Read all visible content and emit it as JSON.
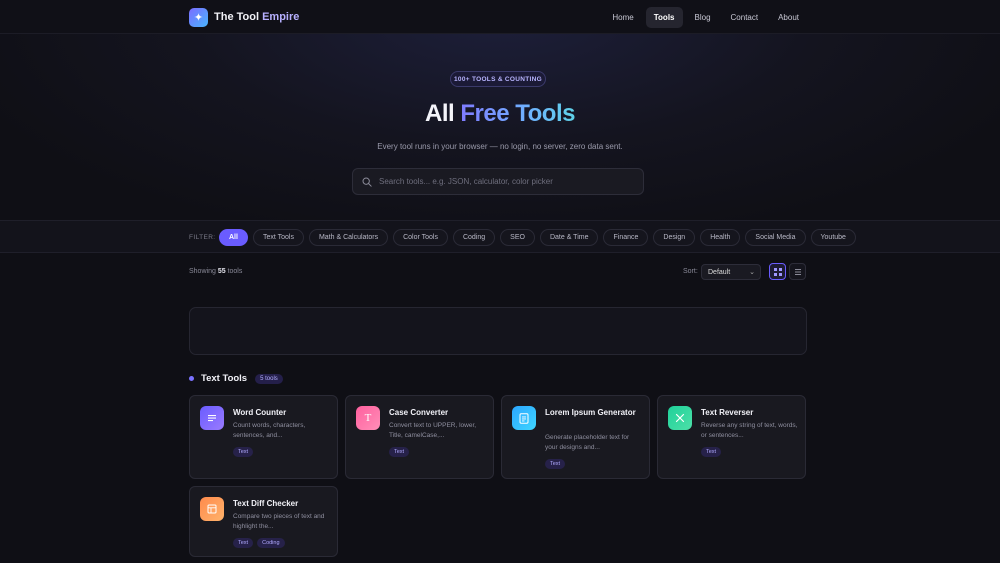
{
  "brand": {
    "name_part1": "The Tool ",
    "name_part2": "Empire"
  },
  "nav": {
    "links": [
      "Home",
      "Tools",
      "Blog",
      "Contact",
      "About"
    ],
    "active": "Tools"
  },
  "hero": {
    "badge": "100+ TOOLS & COUNTING",
    "title_part1": "All",
    "title_part2": "Free Tools",
    "subtitle": "Every tool runs in your browser — no login, no server, zero data sent.",
    "search_placeholder": "Search tools... e.g. JSON, calculator, color picker"
  },
  "filter": {
    "label": "FILTER:",
    "chips": [
      "All",
      "Text Tools",
      "Math & Calculators",
      "Color Tools",
      "Coding",
      "SEO",
      "Date & Time",
      "Finance",
      "Design",
      "Health",
      "Social Media",
      "Youtube"
    ],
    "active": "All"
  },
  "results": {
    "showing_prefix": "Showing",
    "count": "55",
    "showing_suffix": "tools",
    "sort_label": "Sort:",
    "sort_value": "Default"
  },
  "section": {
    "title": "Text Tools",
    "count_label": "5 tools"
  },
  "cards": [
    {
      "title": "Word Counter",
      "desc": "Count words, characters, sentences, and...",
      "tags": [
        "Text"
      ],
      "icon": "lines-icon",
      "color_a": "#6a5cff",
      "color_b": "#9a7bff"
    },
    {
      "title": "Case Converter",
      "desc": "Convert text to UPPER, lower, Title, camelCase,...",
      "tags": [
        "Text"
      ],
      "icon": "letter-t-icon",
      "color_a": "#ff5f9e",
      "color_b": "#ff8fb8"
    },
    {
      "title": "Lorem Ipsum Generator",
      "desc": "Generate placeholder text for your designs and...",
      "tags": [
        "Text"
      ],
      "icon": "document-icon",
      "color_a": "#2ba6ff",
      "color_b": "#3fd6ff"
    },
    {
      "title": "Text Reverser",
      "desc": "Reverse any string of text, words, or sentences...",
      "tags": [
        "Text"
      ],
      "icon": "cross-icon",
      "color_a": "#1fd19a",
      "color_b": "#4de0a8"
    },
    {
      "title": "Text Diff Checker",
      "desc": "Compare two pieces of text and highlight the...",
      "tags": [
        "Text",
        "Coding"
      ],
      "icon": "layout-icon",
      "color_a": "#ff8a4c",
      "color_b": "#ffb36b"
    }
  ]
}
